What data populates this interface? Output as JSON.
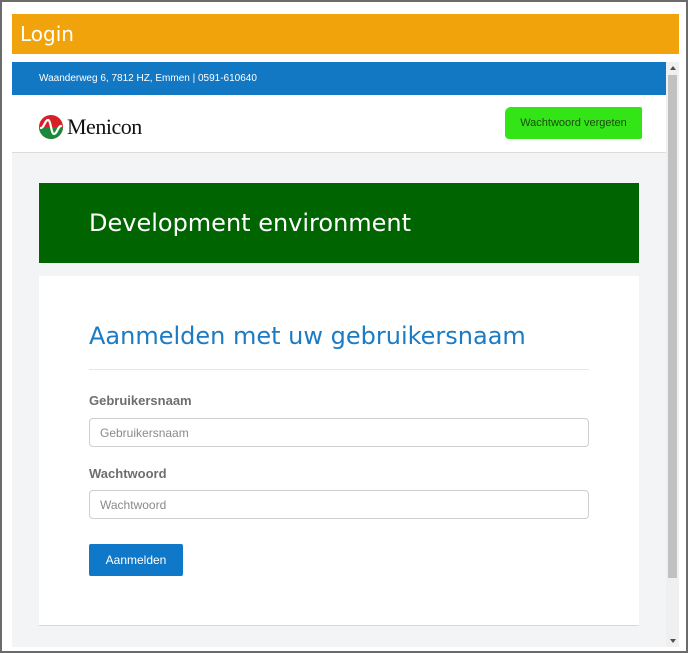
{
  "window": {
    "title": "Login"
  },
  "infobar": {
    "text": "Waanderweg 6, 7812 HZ, Emmen | 0591-610640"
  },
  "header": {
    "logo_text": "Menicon",
    "forgot_password_label": "Wachtwoord vergeten"
  },
  "banner": {
    "text": "Development environment"
  },
  "login": {
    "heading": "Aanmelden met uw gebruikersnaam",
    "username_label": "Gebruikersnaam",
    "username_placeholder": "Gebruikersnaam",
    "username_value": "",
    "password_label": "Wachtwoord",
    "password_placeholder": "Wachtwoord",
    "password_value": "",
    "submit_label": "Aanmelden"
  },
  "colors": {
    "titlebar": "#f0a30a",
    "infobar": "#1378c4",
    "forgot_button": "#33e516",
    "banner": "#006400",
    "heading": "#1b7bc4",
    "submit_button": "#0f78c8"
  },
  "icons": {
    "logo": "menicon-logo-icon",
    "scroll_up": "scroll-up-arrow-icon",
    "scroll_down": "scroll-down-arrow-icon"
  }
}
